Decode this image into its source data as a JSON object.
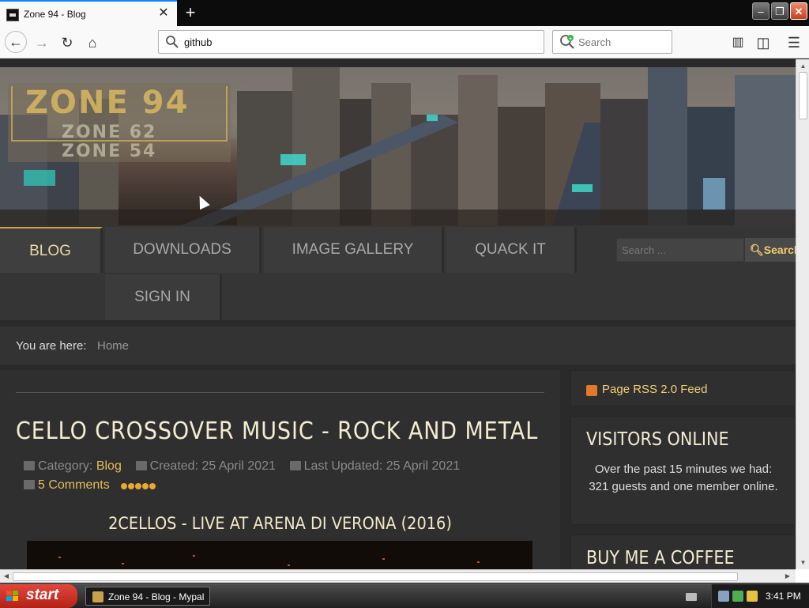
{
  "browser": {
    "tab_title": "Zone 94 - Blog",
    "url": "github",
    "search_placeholder": "Search"
  },
  "site": {
    "logo": {
      "title": "ZONE 94",
      "line1": "ZONE 62",
      "line2": "ZONE 54"
    },
    "menu": [
      "BLOG",
      "DOWNLOADS",
      "IMAGE GALLERY",
      "QUACK IT",
      "SIGN IN"
    ],
    "search_placeholder": "Search ...",
    "search_button": "Search",
    "breadcrumb": {
      "label": "You are here:",
      "home": "Home"
    }
  },
  "article": {
    "title": "CELLO CROSSOVER MUSIC - ROCK AND METAL",
    "category_label": "Category:",
    "category": "Blog",
    "created": "Created: 25 April 2021",
    "updated": "Last Updated: 25 April 2021",
    "comments": "5 Comments",
    "rating": 5,
    "subtitle": "2CELLOS - LIVE AT ARENA DI VERONA (2016)"
  },
  "sidebar": {
    "rss": "Page RSS 2.0 Feed",
    "visitors_title": "VISITORS ONLINE",
    "visitors_text": "Over the past 15 minutes we had: 321 guests and one member online.",
    "coffee_title": "BUY ME A COFFEE"
  },
  "taskbar": {
    "start": "start",
    "window": "Zone 94 - Blog - Mypal",
    "clock": "3:41 PM"
  },
  "colors": {
    "accent_gold": "#e4bd5c",
    "menu_active": "#e9d9a8",
    "heading": "#f3ecd2",
    "start_button": "#d6362a"
  }
}
